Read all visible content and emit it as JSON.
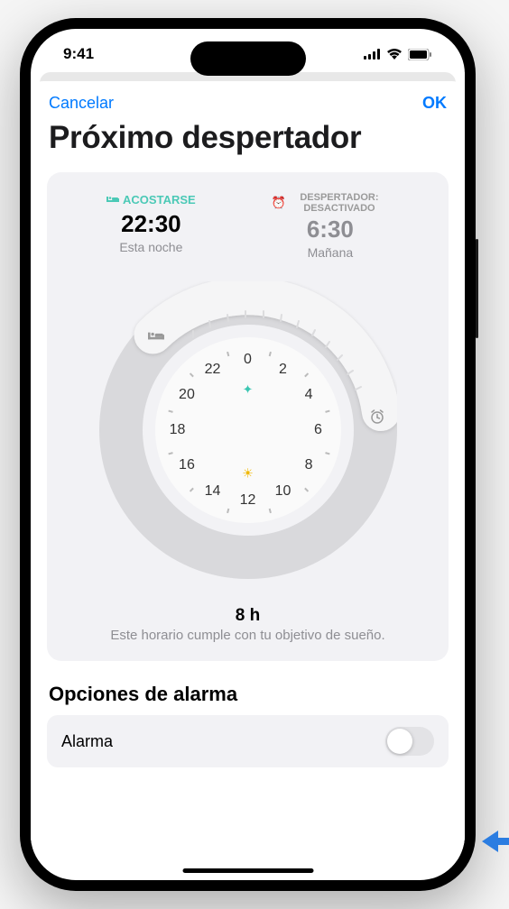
{
  "status": {
    "time": "9:41"
  },
  "modal": {
    "cancel": "Cancelar",
    "ok": "OK"
  },
  "title": "Próximo despertador",
  "sleep": {
    "bedtime": {
      "label": "ACOSTARSE",
      "time": "22:30",
      "sub": "Esta noche"
    },
    "wake": {
      "label": "DESPERTADOR: DESACTIVADO",
      "time": "6:30",
      "sub": "Mañana"
    }
  },
  "clock": {
    "numbers": [
      "0",
      "2",
      "4",
      "6",
      "8",
      "10",
      "12",
      "14",
      "16",
      "18",
      "20",
      "22"
    ]
  },
  "summary": {
    "hours": "8 h",
    "text": "Este horario cumple con tu objetivo de sueño."
  },
  "options": {
    "title": "Opciones de alarma",
    "row1": "Alarma"
  },
  "colors": {
    "accent": "#007AFF",
    "teal": "#3ac6b2"
  }
}
